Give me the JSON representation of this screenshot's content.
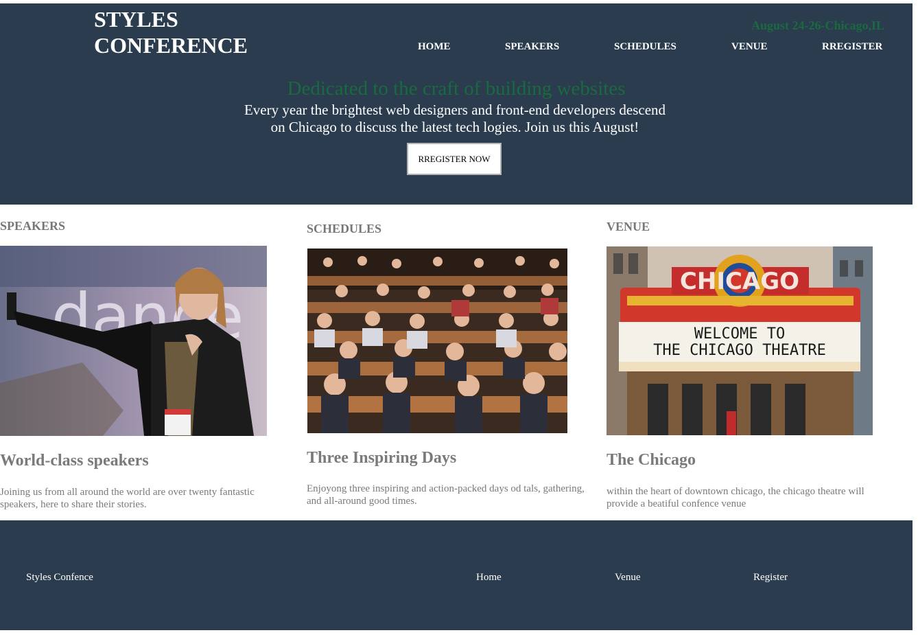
{
  "header": {
    "logo_line1": "STYLES",
    "logo_line2": "CONFERENCE",
    "dateline": "August 24-26-Chicago,IL",
    "nav": [
      "HOME",
      "SPEAKERS",
      "SCHEDULES",
      "VENUE",
      "RREGISTER"
    ]
  },
  "hero": {
    "title": "Dedicated to the craft of building websites",
    "text_line1": "Every year the brightest web designers and front-end developers descend",
    "text_line2": "on Chicago to discuss the latest tech logies. Join us this August!",
    "cta": "RREGISTER NOW"
  },
  "columns": [
    {
      "label": "SPEAKERS",
      "heading": "World-class speakers",
      "text_line1": "Joining us from all around the world are over twenty fantastic",
      "text_line2": "speakers, here to share their stories."
    },
    {
      "label": "SCHEDULES",
      "heading": "Three Inspiring Days",
      "text_line1": "Enjoyong three inspiring and action-packed days od tals, gathering,",
      "text_line2": "and all-around good times."
    },
    {
      "label": "VENUE",
      "heading": "The Chicago",
      "text_line1": "within the heart of downtown chicago, the chicago theatre will",
      "text_line2": "provide a beatiful confence venue",
      "marquee_line1": "WELCOME TO",
      "marquee_line2": "THE CHICAGO THEATRE",
      "sign": "CHICAGO"
    }
  ],
  "footer": {
    "brand": "Styles Confence",
    "links": [
      "Home",
      "Venue",
      "Register"
    ]
  },
  "colors": {
    "header_bg": "#2a3c4e",
    "accent_green": "#1a6a40",
    "muted_text": "#777777"
  }
}
